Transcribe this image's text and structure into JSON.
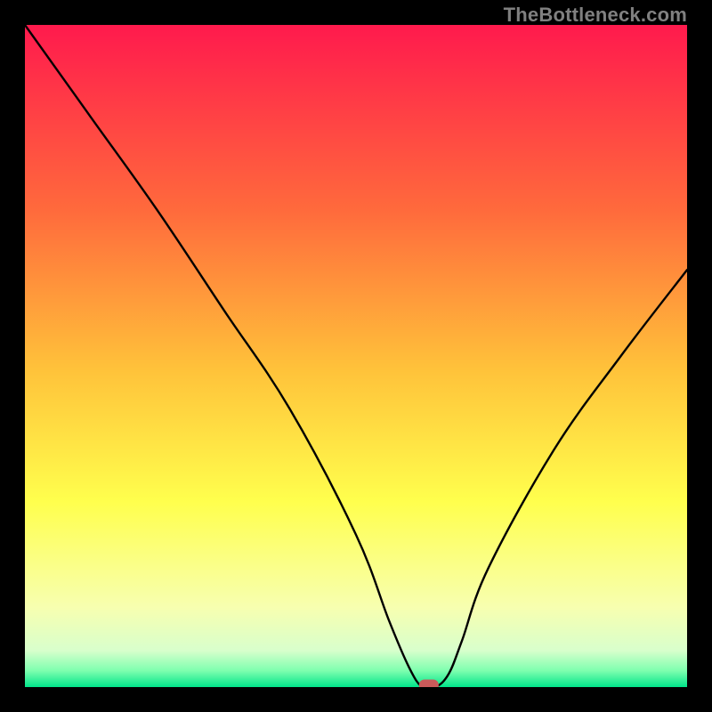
{
  "watermark": "TheBottleneck.com",
  "chart_data": {
    "type": "line",
    "title": "",
    "xlabel": "",
    "ylabel": "",
    "xlim": [
      0,
      100
    ],
    "ylim": [
      0,
      100
    ],
    "x": [
      0,
      10,
      20,
      30,
      40,
      50,
      55,
      58,
      60,
      62,
      64,
      66,
      70,
      80,
      90,
      100
    ],
    "values": [
      100,
      86,
      72,
      57,
      42,
      23,
      10,
      3,
      0,
      0,
      2,
      7,
      18,
      36,
      50,
      63
    ],
    "marker": {
      "x": 61,
      "y": 0,
      "color": "#c95a5a"
    },
    "background": {
      "type": "vertical_gradient",
      "stops": [
        {
          "pos": 0.0,
          "color": "#ff1a4d"
        },
        {
          "pos": 0.28,
          "color": "#ff6a3c"
        },
        {
          "pos": 0.52,
          "color": "#ffc23a"
        },
        {
          "pos": 0.72,
          "color": "#ffff4d"
        },
        {
          "pos": 0.88,
          "color": "#f7ffb0"
        },
        {
          "pos": 0.945,
          "color": "#d8ffcc"
        },
        {
          "pos": 0.975,
          "color": "#7fffaf"
        },
        {
          "pos": 1.0,
          "color": "#00e58a"
        }
      ]
    }
  }
}
